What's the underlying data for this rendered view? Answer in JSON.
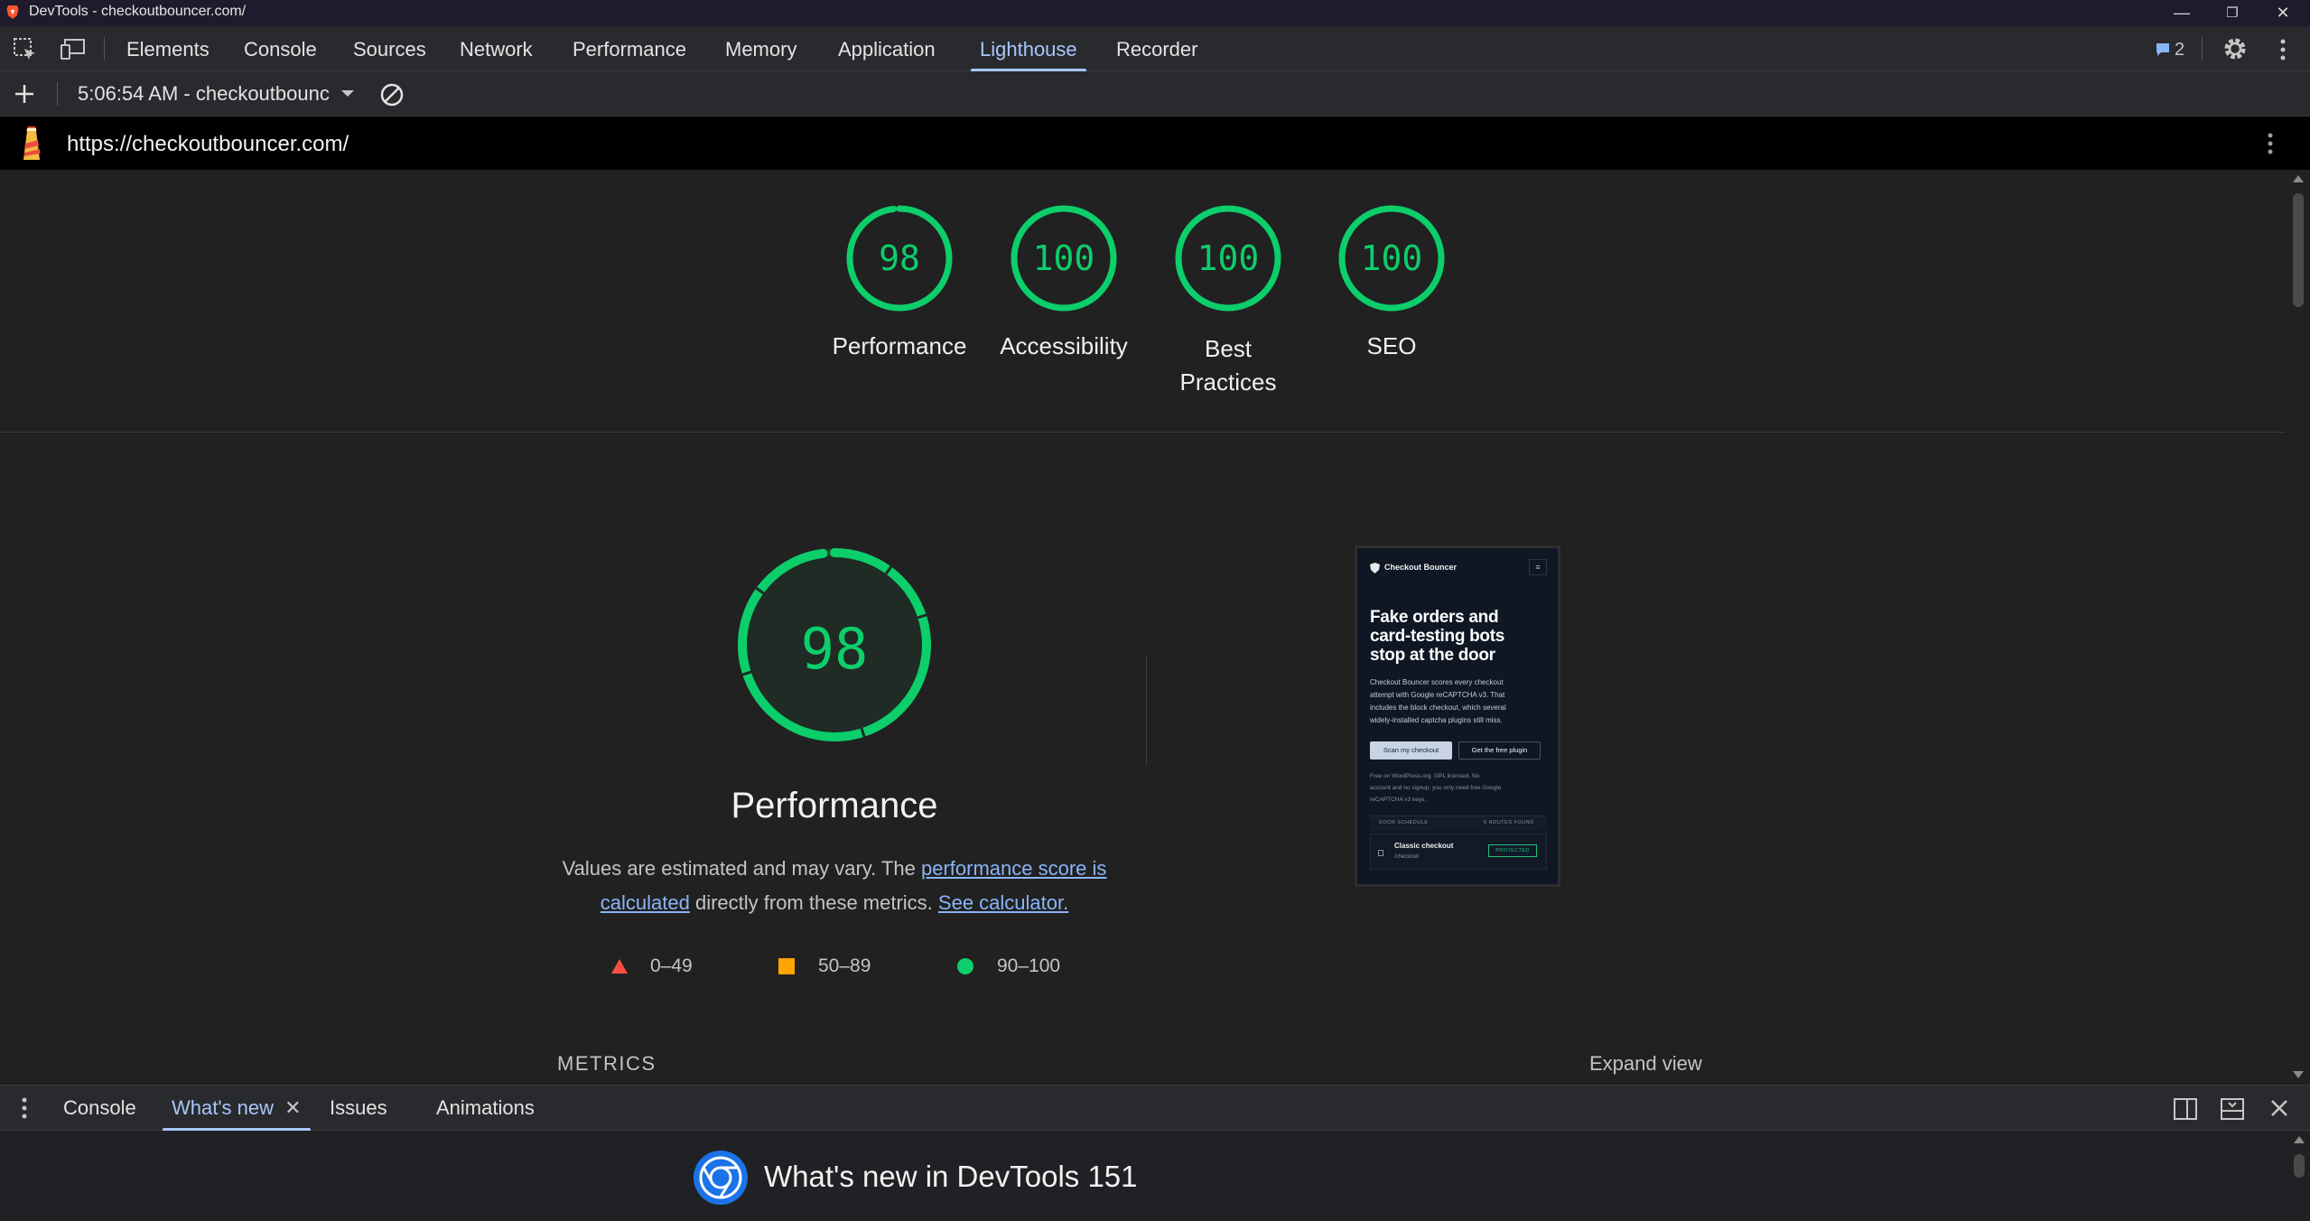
{
  "window": {
    "title": "DevTools - checkoutbouncer.com/"
  },
  "main_tabs": [
    "Elements",
    "Console",
    "Sources",
    "Network",
    "Performance",
    "Memory",
    "Application",
    "Lighthouse",
    "Recorder"
  ],
  "active_tab": "Lighthouse",
  "issues_count": "2",
  "toolbar": {
    "report_select": "5:06:54 AM - checkoutbounc"
  },
  "url_bar": {
    "url": "https://checkoutbouncer.com/"
  },
  "scores": [
    {
      "value": "98",
      "label": "Performance",
      "fraction": 0.98
    },
    {
      "value": "100",
      "label": "Accessibility",
      "fraction": 1.0
    },
    {
      "value": "100",
      "label_line1": "Best",
      "label_line2": "Practices",
      "fraction": 1.0
    },
    {
      "value": "100",
      "label": "SEO",
      "fraction": 1.0
    }
  ],
  "performance": {
    "score": "98",
    "fraction": 0.98,
    "title": "Performance",
    "desc_part1": "Values are estimated and may vary. The ",
    "desc_link1_a": "performance score is",
    "desc_link1_b": "calculated",
    "desc_part2": " directly from these metrics.",
    "desc_link2": "See calculator.",
    "legend": [
      "0–49",
      "50–89",
      "90–100"
    ],
    "metrics_heading": "METRICS",
    "expand_view": "Expand view"
  },
  "screenshot": {
    "brand": "Checkout Bouncer",
    "headline_1": "Fake orders and",
    "headline_2": "card-testing bots",
    "headline_3": "stop at the door",
    "body_1": "Checkout Bouncer scores every checkout",
    "body_2": "attempt with Google reCAPTCHA v3. That",
    "body_3": "includes the block checkout, which several",
    "body_4": "widely-installed captcha plugins still miss.",
    "btn_primary": "Scan my checkout",
    "btn_secondary": "Get the free plugin",
    "small_1": "Free on WordPress.org. GPL licensed. No",
    "small_2": "account and no signup: you only need free Google",
    "small_3": "reCAPTCHA v3 keys.",
    "table_left": "DOOR SCHEDULE",
    "table_right": "6 ROUTES FOUND",
    "row_title": "Classic checkout",
    "row_sub": "/checkout/",
    "row_badge": "PROTECTED"
  },
  "drawer": {
    "tabs": [
      "Console",
      "What's new",
      "Issues",
      "Animations"
    ],
    "active_tab": "What's new",
    "heading": "What's new in DevTools 151"
  },
  "colors": {
    "pass": "#0cce6b",
    "average": "#ffa400",
    "fail": "#ff4e42",
    "accent": "#a8c7fa"
  }
}
